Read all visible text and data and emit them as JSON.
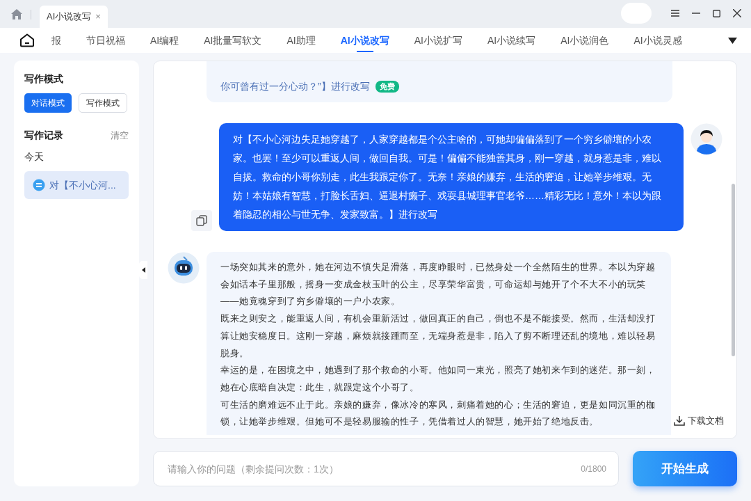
{
  "titlebar": {
    "tab": {
      "label": "AI小说改写",
      "close": "×"
    }
  },
  "nav": {
    "tabs": [
      {
        "label": "报",
        "selected": false
      },
      {
        "label": "节日祝福",
        "selected": false
      },
      {
        "label": "AI编程",
        "selected": false
      },
      {
        "label": "AI批量写软文",
        "selected": false
      },
      {
        "label": "AI助理",
        "selected": false
      },
      {
        "label": "AI小说改写",
        "selected": true
      },
      {
        "label": "AI小说扩写",
        "selected": false
      },
      {
        "label": "AI小说续写",
        "selected": false
      },
      {
        "label": "AI小说润色",
        "selected": false
      },
      {
        "label": "AI小说灵感",
        "selected": false
      }
    ]
  },
  "sidebar": {
    "mode_title": "写作模式",
    "modes": [
      {
        "label": "对话模式",
        "selected": true
      },
      {
        "label": "写作模式",
        "selected": false
      }
    ],
    "history_title": "写作记录",
    "clear": "清空",
    "group": "今天",
    "items": [
      {
        "label": "对【不小心河...",
        "selected": true
      }
    ]
  },
  "chat": {
    "messages": [
      {
        "kind": "prompt",
        "text": "你可曾有过一分心动？”】进行改写",
        "badge": "免费"
      },
      {
        "kind": "user",
        "text": "对【不小心河边失足她穿越了，人家穿越都是个公主啥的，可她却偏偏落到了一个穷乡僻壤的小农家。也罢！至少可以重返人间，做回自我。可是！偏偏不能独善其身，刚一穿越，就身惹是非，难以自拔。救命的小哥你别走，此生我跟定你了。无奈！亲娘的嫌弃，生活的窘迫，让她举步维艰。无妨！本姑娘有智慧，打脸长舌妇、逼退村癞子、戏耍县城理事官老爷……精彩无比！意外！本以为跟着隐忍的相公与世无争、发家致富。】进行改写"
      },
      {
        "kind": "ai",
        "paragraphs": [
          "一场突如其来的意外，她在河边不慎失足滑落，再度睁眼时，已然身处一个全然陌生的世界。本以为穿越会如话本子里那般，摇身一变成金枝玉叶的公主，尽享荣华富贵，可命运却与她开了个不大不小的玩笑——她竟魂穿到了穷乡僻壤的一户小农家。",
          "既来之则安之，能重返人间，有机会重新活过，做回真正的自己，倒也不是不能接受。然而，生活却没打算让她安稳度日。这刚一穿越，麻烦就接踵而至，无端身惹是非，陷入了剪不断理还乱的境地，难以轻易脱身。",
          "幸运的是，在困境之中，她遇到了那个救命的小哥。他如同一束光，照亮了她初来乍到的迷茫。那一刻，她在心底暗自决定：此生，就跟定这个小哥了。",
          "可生活的磨难远不止于此。亲娘的嫌弃，像冰冷的寒风，刺痛着她的心；生活的窘迫，更是如同沉重的枷锁，让她举步维艰。但她可不是轻易服输的性子，凭借着过人的智慧，她开始了绝地反击。"
        ],
        "download": "下载文档"
      }
    ]
  },
  "input": {
    "placeholder": "请输入你的问题（剩余提问次数：1次）",
    "counter": "0/1800"
  },
  "submit": "开始生成"
}
